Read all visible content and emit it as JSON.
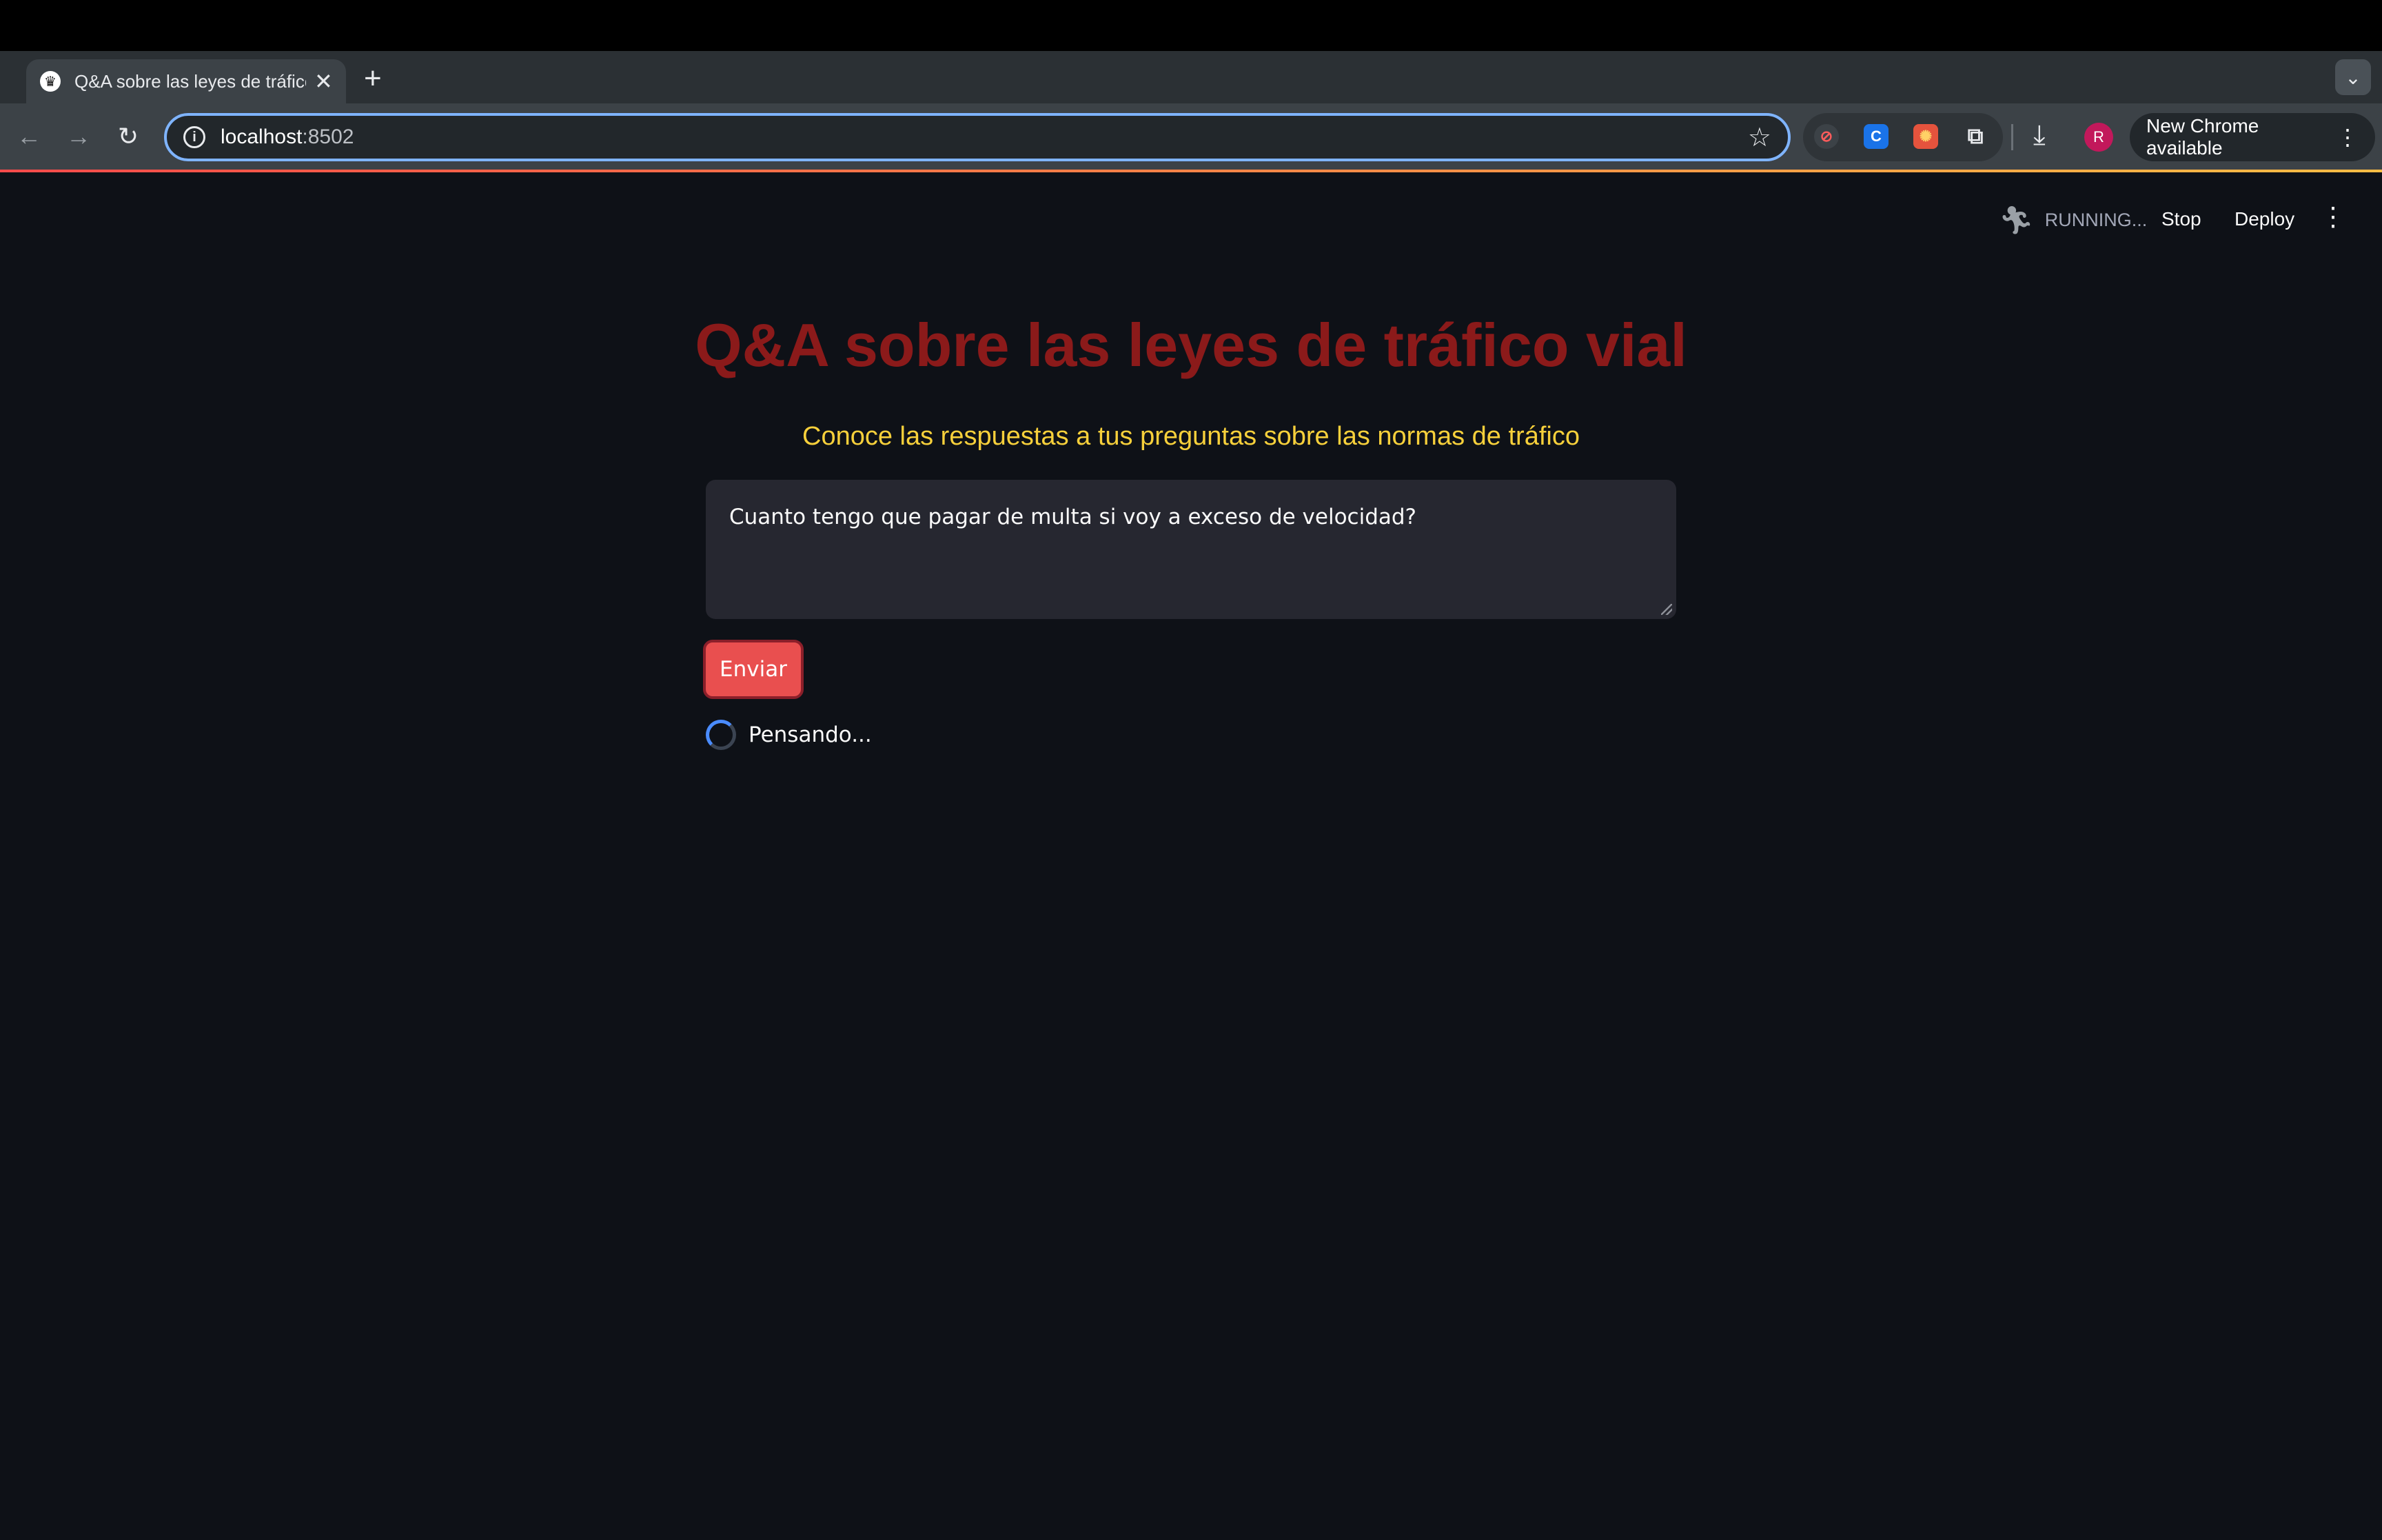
{
  "browser": {
    "tab_title": "Q&A sobre las leyes de tráfico",
    "tab_close": "✕",
    "new_tab": "+",
    "url_host": "localhost",
    "url_port": ":8502",
    "update_label": "New Chrome available",
    "avatar_initial": "R",
    "extension_c_label": "C"
  },
  "app_header": {
    "status": "RUNNING...",
    "stop_label": "Stop",
    "deploy_label": "Deploy"
  },
  "main": {
    "title": "Q&A sobre las leyes de tráfico vial",
    "subtitle": "Conoce las respuestas a tus preguntas sobre las normas de tráfico",
    "question_value": "Cuanto tengo que pagar de multa si voy a exceso de velocidad?",
    "submit_label": "Enviar",
    "spinner_text": "Pensando..."
  },
  "colors": {
    "title": "#8b1a1a",
    "subtitle": "#f7d03b",
    "button": "#e94f4f",
    "background": "#0e1117"
  }
}
